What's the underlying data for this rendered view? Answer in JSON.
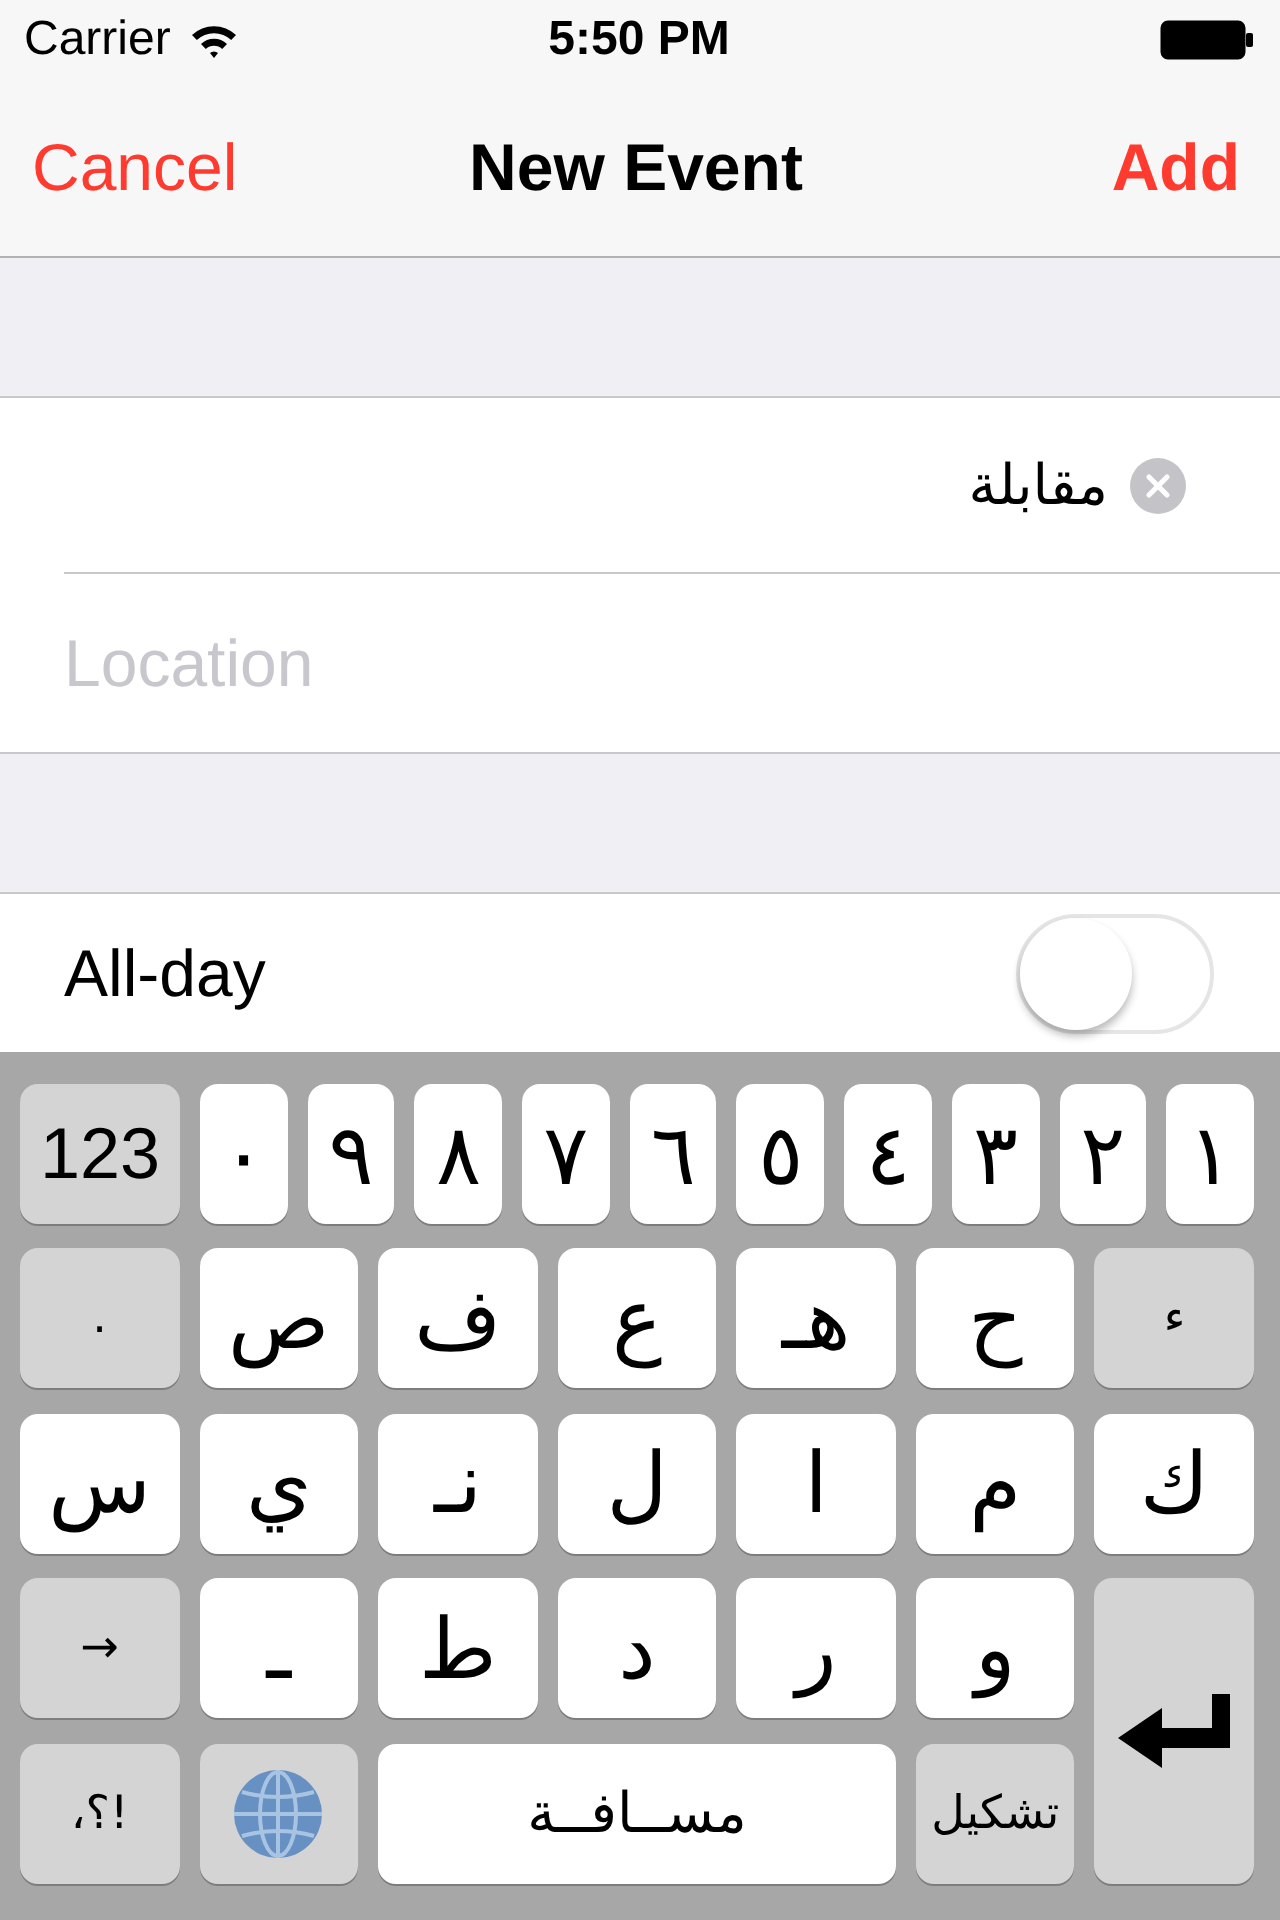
{
  "status_bar": {
    "carrier": "Carrier",
    "time": "5:50 PM"
  },
  "nav_bar": {
    "cancel": "Cancel",
    "title": "New Event",
    "add": "Add"
  },
  "form": {
    "title_field": {
      "value": "مقابلة"
    },
    "location_field": {
      "placeholder": "Location"
    },
    "all_day": {
      "label": "All-day",
      "on": false
    }
  },
  "keyboard": {
    "number_row": [
      {
        "kind": "char",
        "label": "١"
      },
      {
        "kind": "char",
        "label": "٢"
      },
      {
        "kind": "char",
        "label": "٣"
      },
      {
        "kind": "char",
        "label": "٤"
      },
      {
        "kind": "char",
        "label": "٥"
      },
      {
        "kind": "char",
        "label": "٦"
      },
      {
        "kind": "char",
        "label": "٧"
      },
      {
        "kind": "char",
        "label": "٨"
      },
      {
        "kind": "char",
        "label": "٩"
      },
      {
        "kind": "char",
        "label": "٠"
      },
      {
        "kind": "function",
        "label": "123"
      }
    ],
    "rows": [
      [
        {
          "kind": "function",
          "label": "ء"
        },
        {
          "kind": "char",
          "label": "ح"
        },
        {
          "kind": "char",
          "label": "هـ"
        },
        {
          "kind": "char",
          "label": "ع"
        },
        {
          "kind": "char",
          "label": "ف"
        },
        {
          "kind": "char",
          "label": "ص"
        },
        {
          "kind": "function",
          "label": "."
        }
      ],
      [
        {
          "kind": "char",
          "label": "ك"
        },
        {
          "kind": "char",
          "label": "م"
        },
        {
          "kind": "char",
          "label": "ا"
        },
        {
          "kind": "char",
          "label": "ل"
        },
        {
          "kind": "char",
          "label": "نـ"
        },
        {
          "kind": "char",
          "label": "ي"
        },
        {
          "kind": "char",
          "label": "س"
        }
      ],
      [
        {
          "kind": "return"
        },
        {
          "kind": "char",
          "label": "و"
        },
        {
          "kind": "char",
          "label": "ر"
        },
        {
          "kind": "char",
          "label": "د"
        },
        {
          "kind": "char",
          "label": "ط"
        },
        {
          "kind": "char",
          "label": "ـ"
        },
        {
          "kind": "function",
          "label": "→"
        }
      ],
      [
        "",
        {
          "kind": "function",
          "label": "تشكيل"
        },
        "",
        {
          "kind": "space",
          "label": "مســافــة"
        },
        "",
        {
          "kind": "globe"
        },
        {
          "kind": "function",
          "label": "!؟،"
        }
      ]
    ]
  }
}
